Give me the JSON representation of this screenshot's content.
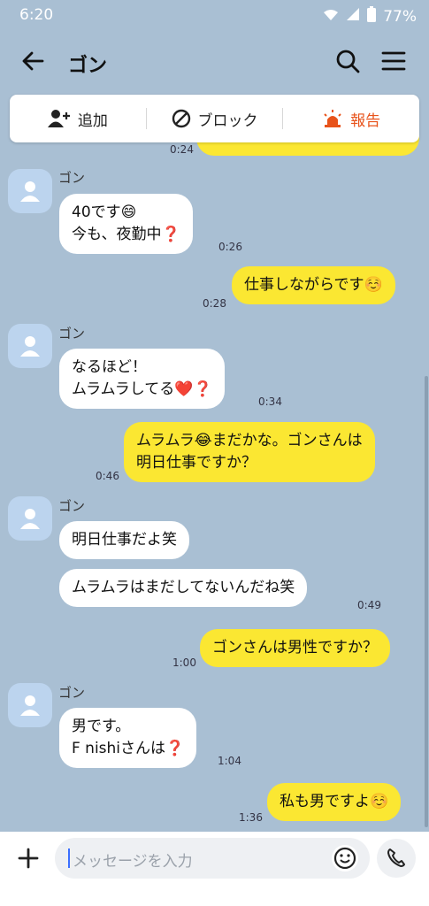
{
  "status": {
    "time": "6:20",
    "battery": "77%"
  },
  "header": {
    "title": "ゴン"
  },
  "actions": {
    "add": "追加",
    "block": "ブロック",
    "report": "報告"
  },
  "messages": [
    {
      "time": "0:24"
    },
    {
      "sender": "ゴン",
      "text": "40です😄\n今も、夜勤中❓",
      "time": "0:26"
    },
    {
      "text": "仕事しながらです☺️",
      "time": "0:28"
    },
    {
      "sender": "ゴン",
      "text": "なるほど！\nムラムラしてる❤️❓",
      "time": "0:34"
    },
    {
      "text": "ムラムラ😂まだかな。ゴンさんは\n明日仕事ですか？",
      "time": "0:46"
    },
    {
      "sender": "ゴン",
      "text": "明日仕事だよ笑"
    },
    {
      "text": "ムラムラはまだしてないんだね笑",
      "time": "0:49"
    },
    {
      "text": "ゴンさんは男性ですか？",
      "time": "1:00"
    },
    {
      "sender": "ゴン",
      "text": "男です。\nF nishiさんは❓",
      "time": "1:04"
    },
    {
      "text": "私も男ですよ☺️",
      "time": "1:36"
    }
  ],
  "input": {
    "placeholder": "メッセージを入力"
  },
  "colors": {
    "background": "#a9bfd3",
    "outgoing": "#fbe732",
    "incoming": "#ffffff",
    "report": "#e8531b"
  }
}
